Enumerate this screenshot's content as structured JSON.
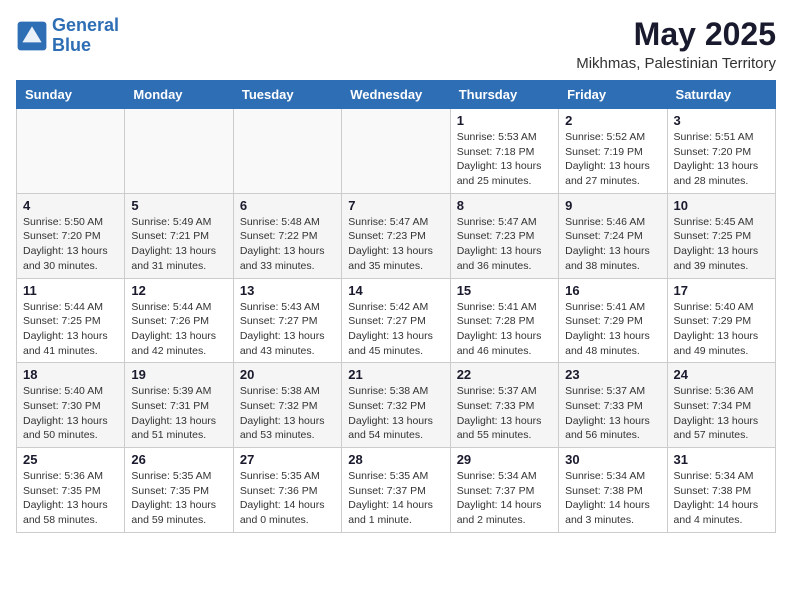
{
  "logo": {
    "line1": "General",
    "line2": "Blue"
  },
  "title": "May 2025",
  "location": "Mikhmas, Palestinian Territory",
  "weekdays": [
    "Sunday",
    "Monday",
    "Tuesday",
    "Wednesday",
    "Thursday",
    "Friday",
    "Saturday"
  ],
  "weeks": [
    [
      {
        "day": "",
        "info": ""
      },
      {
        "day": "",
        "info": ""
      },
      {
        "day": "",
        "info": ""
      },
      {
        "day": "",
        "info": ""
      },
      {
        "day": "1",
        "info": "Sunrise: 5:53 AM\nSunset: 7:18 PM\nDaylight: 13 hours\nand 25 minutes."
      },
      {
        "day": "2",
        "info": "Sunrise: 5:52 AM\nSunset: 7:19 PM\nDaylight: 13 hours\nand 27 minutes."
      },
      {
        "day": "3",
        "info": "Sunrise: 5:51 AM\nSunset: 7:20 PM\nDaylight: 13 hours\nand 28 minutes."
      }
    ],
    [
      {
        "day": "4",
        "info": "Sunrise: 5:50 AM\nSunset: 7:20 PM\nDaylight: 13 hours\nand 30 minutes."
      },
      {
        "day": "5",
        "info": "Sunrise: 5:49 AM\nSunset: 7:21 PM\nDaylight: 13 hours\nand 31 minutes."
      },
      {
        "day": "6",
        "info": "Sunrise: 5:48 AM\nSunset: 7:22 PM\nDaylight: 13 hours\nand 33 minutes."
      },
      {
        "day": "7",
        "info": "Sunrise: 5:47 AM\nSunset: 7:23 PM\nDaylight: 13 hours\nand 35 minutes."
      },
      {
        "day": "8",
        "info": "Sunrise: 5:47 AM\nSunset: 7:23 PM\nDaylight: 13 hours\nand 36 minutes."
      },
      {
        "day": "9",
        "info": "Sunrise: 5:46 AM\nSunset: 7:24 PM\nDaylight: 13 hours\nand 38 minutes."
      },
      {
        "day": "10",
        "info": "Sunrise: 5:45 AM\nSunset: 7:25 PM\nDaylight: 13 hours\nand 39 minutes."
      }
    ],
    [
      {
        "day": "11",
        "info": "Sunrise: 5:44 AM\nSunset: 7:25 PM\nDaylight: 13 hours\nand 41 minutes."
      },
      {
        "day": "12",
        "info": "Sunrise: 5:44 AM\nSunset: 7:26 PM\nDaylight: 13 hours\nand 42 minutes."
      },
      {
        "day": "13",
        "info": "Sunrise: 5:43 AM\nSunset: 7:27 PM\nDaylight: 13 hours\nand 43 minutes."
      },
      {
        "day": "14",
        "info": "Sunrise: 5:42 AM\nSunset: 7:27 PM\nDaylight: 13 hours\nand 45 minutes."
      },
      {
        "day": "15",
        "info": "Sunrise: 5:41 AM\nSunset: 7:28 PM\nDaylight: 13 hours\nand 46 minutes."
      },
      {
        "day": "16",
        "info": "Sunrise: 5:41 AM\nSunset: 7:29 PM\nDaylight: 13 hours\nand 48 minutes."
      },
      {
        "day": "17",
        "info": "Sunrise: 5:40 AM\nSunset: 7:29 PM\nDaylight: 13 hours\nand 49 minutes."
      }
    ],
    [
      {
        "day": "18",
        "info": "Sunrise: 5:40 AM\nSunset: 7:30 PM\nDaylight: 13 hours\nand 50 minutes."
      },
      {
        "day": "19",
        "info": "Sunrise: 5:39 AM\nSunset: 7:31 PM\nDaylight: 13 hours\nand 51 minutes."
      },
      {
        "day": "20",
        "info": "Sunrise: 5:38 AM\nSunset: 7:32 PM\nDaylight: 13 hours\nand 53 minutes."
      },
      {
        "day": "21",
        "info": "Sunrise: 5:38 AM\nSunset: 7:32 PM\nDaylight: 13 hours\nand 54 minutes."
      },
      {
        "day": "22",
        "info": "Sunrise: 5:37 AM\nSunset: 7:33 PM\nDaylight: 13 hours\nand 55 minutes."
      },
      {
        "day": "23",
        "info": "Sunrise: 5:37 AM\nSunset: 7:33 PM\nDaylight: 13 hours\nand 56 minutes."
      },
      {
        "day": "24",
        "info": "Sunrise: 5:36 AM\nSunset: 7:34 PM\nDaylight: 13 hours\nand 57 minutes."
      }
    ],
    [
      {
        "day": "25",
        "info": "Sunrise: 5:36 AM\nSunset: 7:35 PM\nDaylight: 13 hours\nand 58 minutes."
      },
      {
        "day": "26",
        "info": "Sunrise: 5:35 AM\nSunset: 7:35 PM\nDaylight: 13 hours\nand 59 minutes."
      },
      {
        "day": "27",
        "info": "Sunrise: 5:35 AM\nSunset: 7:36 PM\nDaylight: 14 hours\nand 0 minutes."
      },
      {
        "day": "28",
        "info": "Sunrise: 5:35 AM\nSunset: 7:37 PM\nDaylight: 14 hours\nand 1 minute."
      },
      {
        "day": "29",
        "info": "Sunrise: 5:34 AM\nSunset: 7:37 PM\nDaylight: 14 hours\nand 2 minutes."
      },
      {
        "day": "30",
        "info": "Sunrise: 5:34 AM\nSunset: 7:38 PM\nDaylight: 14 hours\nand 3 minutes."
      },
      {
        "day": "31",
        "info": "Sunrise: 5:34 AM\nSunset: 7:38 PM\nDaylight: 14 hours\nand 4 minutes."
      }
    ]
  ]
}
